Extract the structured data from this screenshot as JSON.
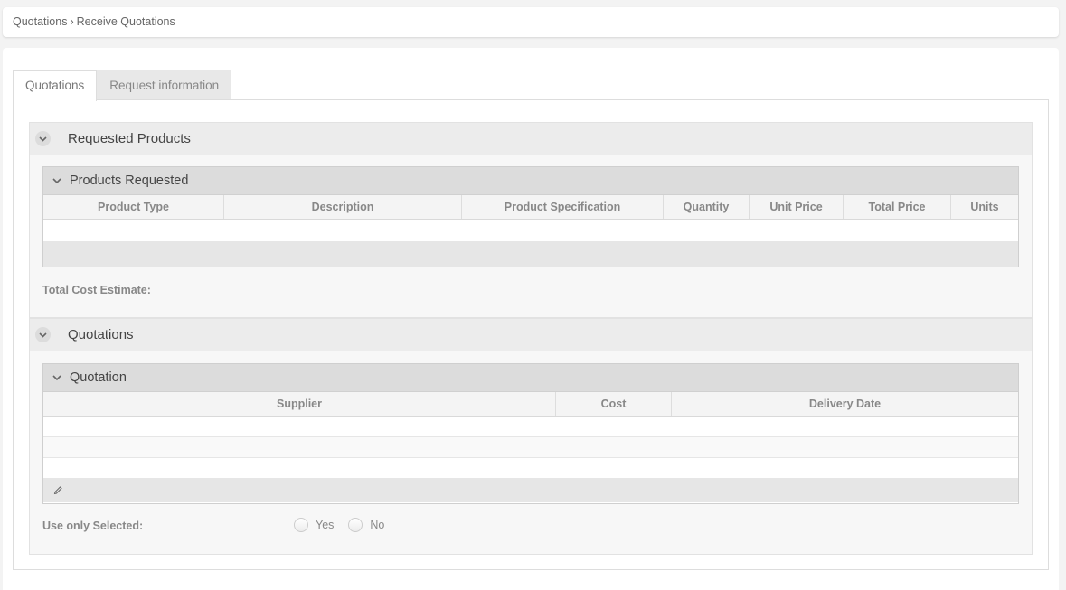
{
  "breadcrumb": {
    "parent": "Quotations",
    "separator": "›",
    "current": "Receive Quotations"
  },
  "tabs": [
    {
      "label": "Quotations",
      "active": true
    },
    {
      "label": "Request information",
      "active": false
    }
  ],
  "requested_products": {
    "title": "Requested Products",
    "grid_title": "Products Requested",
    "columns": [
      "Product Type",
      "Description",
      "Product Specification",
      "Quantity",
      "Unit Price",
      "Total Price",
      "Units"
    ],
    "total_label": "Total Cost Estimate:",
    "total_value": ""
  },
  "quotations": {
    "title": "Quotations",
    "grid_title": "Quotation",
    "columns": [
      "Supplier",
      "Cost",
      "Delivery Date"
    ],
    "use_only_selected_label": "Use only Selected:",
    "options": [
      "Yes",
      "No"
    ]
  },
  "icons": {
    "collapse": "chevron-down-icon",
    "edit": "pencil-icon"
  },
  "colors": {
    "section_header_bg": "#ececec",
    "grid_caption_bg": "#dcdcdc",
    "header_text": "#888888"
  }
}
